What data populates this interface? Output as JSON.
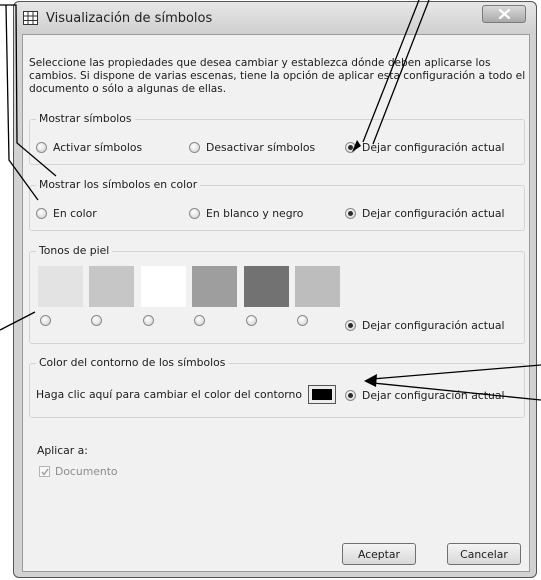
{
  "window": {
    "title": "Visualización de símbolos",
    "icon": "grid-icon"
  },
  "intro": "Seleccione las propiedades que desea cambiar y establezca dónde deben aplicarse los cambios. Si dispone de varias escenas, tiene la opción de aplicar esta configuración a todo el documento o sólo a algunas de ellas.",
  "groups": {
    "mostrar": {
      "title": "Mostrar símbolos",
      "options": [
        "Activar símbolos",
        "Desactivar símbolos",
        "Dejar configuración actual"
      ],
      "selected": 2
    },
    "color": {
      "title": "Mostrar los símbolos en color",
      "options": [
        "En color",
        "En blanco y negro",
        "Dejar configuración actual"
      ],
      "selected": 2
    },
    "tonos": {
      "title": "Tonos de piel",
      "swatches": [
        "#e3e3e3",
        "#c6c6c6",
        "#ffffff",
        "#9e9e9e",
        "#727272",
        "#bdbdbd"
      ],
      "keep_label": "Dejar configuración actual",
      "selected": "keep"
    },
    "contorno": {
      "title": "Color del contorno de los símbolos",
      "label": "Haga clic aquí para cambiar el color del contorno",
      "color": "#000000",
      "keep_label": "Dejar configuración actual",
      "selected": "keep"
    }
  },
  "apply": {
    "label": "Aplicar a:",
    "checkbox_label": "Documento",
    "checked": true
  },
  "buttons": {
    "ok": "Aceptar",
    "cancel": "Cancelar"
  }
}
